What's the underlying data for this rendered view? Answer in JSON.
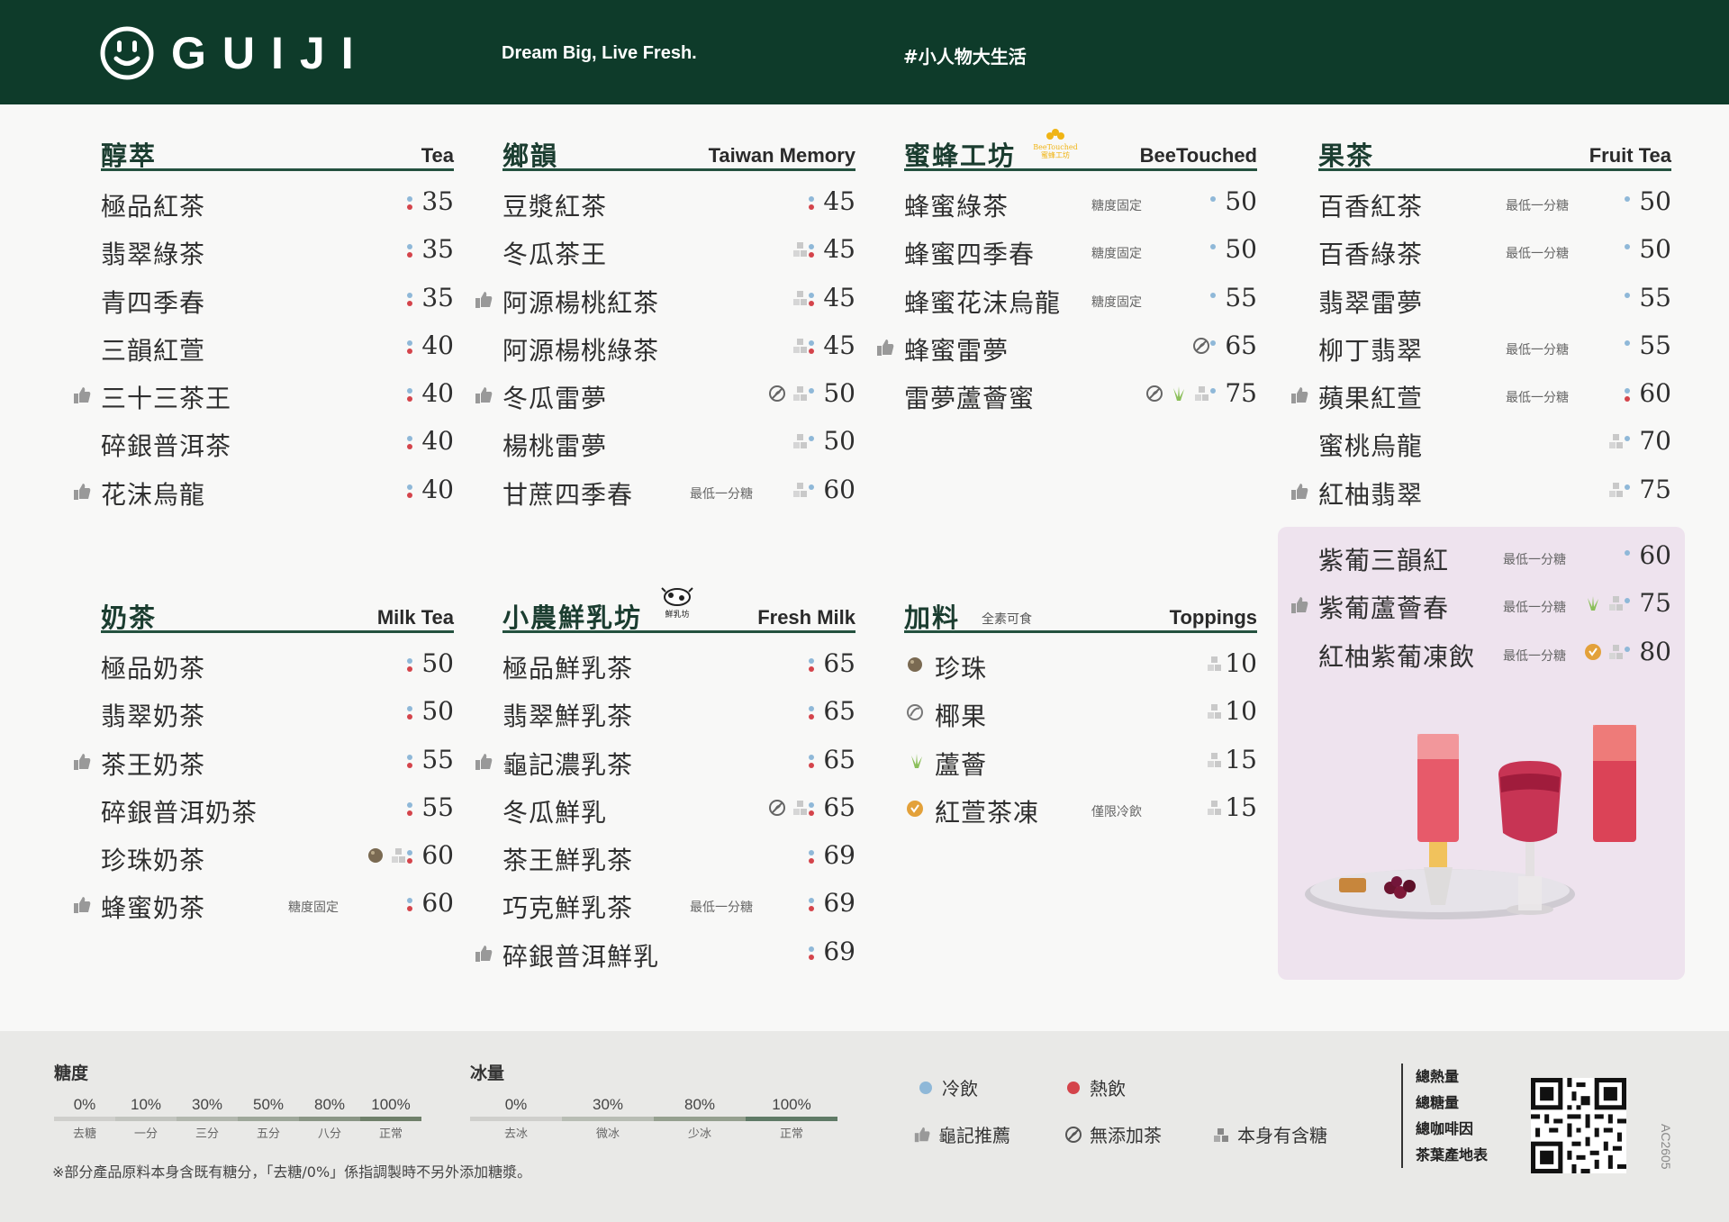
{
  "brand": {
    "name": "GUIJI",
    "tagline": "Dream Big, Live Fresh.",
    "hashtag": "#小人物大生活",
    "color": "#0e3b2a"
  },
  "sections": [
    {
      "id": "tea",
      "title_zh": "醇萃",
      "title_en": "Tea",
      "items": [
        {
          "name": "極品紅茶",
          "price": "35",
          "temp": "both"
        },
        {
          "name": "翡翠綠茶",
          "price": "35",
          "temp": "both"
        },
        {
          "name": "青四季春",
          "price": "35",
          "temp": "both"
        },
        {
          "name": "三韻紅萱",
          "price": "40",
          "temp": "both"
        },
        {
          "name": "三十三茶王",
          "price": "40",
          "temp": "both",
          "rec": true
        },
        {
          "name": "碎銀普洱茶",
          "price": "40",
          "temp": "both"
        },
        {
          "name": "花沫烏龍",
          "price": "40",
          "temp": "both",
          "rec": true
        }
      ]
    },
    {
      "id": "taiwan",
      "title_zh": "鄉韻",
      "title_en": "Taiwan Memory",
      "items": [
        {
          "name": "豆漿紅茶",
          "price": "45",
          "temp": "both"
        },
        {
          "name": "冬瓜茶王",
          "price": "45",
          "temp": "both",
          "icons": [
            "sugar"
          ]
        },
        {
          "name": "阿源楊桃紅茶",
          "price": "45",
          "temp": "both",
          "icons": [
            "sugar"
          ],
          "rec": true
        },
        {
          "name": "阿源楊桃綠茶",
          "price": "45",
          "temp": "both",
          "icons": [
            "sugar"
          ]
        },
        {
          "name": "冬瓜雷夢",
          "price": "50",
          "temp": "cold",
          "icons": [
            "notea",
            "sugar"
          ],
          "rec": true
        },
        {
          "name": "楊桃雷夢",
          "price": "50",
          "temp": "cold",
          "icons": [
            "sugar"
          ]
        },
        {
          "name": "甘蔗四季春",
          "price": "60",
          "temp": "cold",
          "icons": [
            "sugar"
          ],
          "note": "最低一分糖"
        }
      ]
    },
    {
      "id": "bee",
      "title_zh": "蜜蜂工坊",
      "title_en": "BeeTouched",
      "badge_en": "BeeTouched",
      "badge_zh": "蜜蜂工坊",
      "items": [
        {
          "name": "蜂蜜綠茶",
          "price": "50",
          "temp": "cold",
          "note": "糖度固定"
        },
        {
          "name": "蜂蜜四季春",
          "price": "50",
          "temp": "cold",
          "note": "糖度固定"
        },
        {
          "name": "蜂蜜花沫烏龍",
          "price": "55",
          "temp": "cold",
          "note": "糖度固定"
        },
        {
          "name": "蜂蜜雷夢",
          "price": "65",
          "temp": "cold",
          "icons": [
            "notea"
          ],
          "rec": true
        },
        {
          "name": "雷夢蘆薈蜜",
          "price": "75",
          "temp": "cold",
          "icons": [
            "notea",
            "aloe",
            "sugar"
          ]
        }
      ]
    },
    {
      "id": "fruit",
      "title_zh": "果茶",
      "title_en": "Fruit Tea",
      "items": [
        {
          "name": "百香紅茶",
          "price": "50",
          "temp": "cold",
          "note": "最低一分糖"
        },
        {
          "name": "百香綠茶",
          "price": "50",
          "temp": "cold",
          "note": "最低一分糖"
        },
        {
          "name": "翡翠雷夢",
          "price": "55",
          "temp": "cold"
        },
        {
          "name": "柳丁翡翠",
          "price": "55",
          "temp": "cold",
          "note": "最低一分糖"
        },
        {
          "name": "蘋果紅萱",
          "price": "60",
          "temp": "both",
          "note": "最低一分糖",
          "rec": true
        },
        {
          "name": "蜜桃烏龍",
          "price": "70",
          "temp": "cold",
          "icons": [
            "sugar"
          ]
        },
        {
          "name": "紅柚翡翠",
          "price": "75",
          "temp": "cold",
          "icons": [
            "sugar"
          ],
          "rec": true
        }
      ]
    },
    {
      "id": "grape",
      "title_zh": "",
      "title_en": "",
      "items": [
        {
          "name": "紫葡三韻紅",
          "price": "60",
          "temp": "cold",
          "note": "最低一分糖"
        },
        {
          "name": "紫葡蘆薈春",
          "price": "75",
          "temp": "cold",
          "note": "最低一分糖",
          "icons": [
            "aloe",
            "sugar"
          ],
          "rec": true
        },
        {
          "name": "紅柚紫葡凍飲",
          "price": "80",
          "temp": "cold",
          "note": "最低一分糖",
          "icons": [
            "jelly",
            "sugar"
          ]
        }
      ]
    },
    {
      "id": "milk",
      "title_zh": "奶茶",
      "title_en": "Milk Tea",
      "items": [
        {
          "name": "極品奶茶",
          "price": "50",
          "temp": "both"
        },
        {
          "name": "翡翠奶茶",
          "price": "50",
          "temp": "both"
        },
        {
          "name": "茶王奶茶",
          "price": "55",
          "temp": "both",
          "rec": true
        },
        {
          "name": "碎銀普洱奶茶",
          "price": "55",
          "temp": "both"
        },
        {
          "name": "珍珠奶茶",
          "price": "60",
          "temp": "both",
          "icons": [
            "pearl",
            "sugar"
          ]
        },
        {
          "name": "蜂蜜奶茶",
          "price": "60",
          "temp": "both",
          "note": "糖度固定",
          "rec": true
        }
      ]
    },
    {
      "id": "freshmilk",
      "title_zh": "小農鮮乳坊",
      "title_en": "Fresh Milk",
      "badge_zh": "鮮乳坊",
      "items": [
        {
          "name": "極品鮮乳茶",
          "price": "65",
          "temp": "both"
        },
        {
          "name": "翡翠鮮乳茶",
          "price": "65",
          "temp": "both"
        },
        {
          "name": "龜記濃乳茶",
          "price": "65",
          "temp": "both",
          "rec": true
        },
        {
          "name": "冬瓜鮮乳",
          "price": "65",
          "temp": "both",
          "icons": [
            "notea",
            "sugar"
          ]
        },
        {
          "name": "茶王鮮乳茶",
          "price": "69",
          "temp": "both"
        },
        {
          "name": "巧克鮮乳茶",
          "price": "69",
          "temp": "both",
          "note": "最低一分糖"
        },
        {
          "name": "碎銀普洱鮮乳",
          "price": "69",
          "temp": "both",
          "rec": true
        }
      ]
    },
    {
      "id": "toppings",
      "title_zh": "加料",
      "title_en": "Toppings",
      "note": "全素可食",
      "items": [
        {
          "name": "珍珠",
          "price": "10",
          "icon": "pearl",
          "icons": [
            "sugar"
          ]
        },
        {
          "name": "椰果",
          "price": "10",
          "icon": "coconut",
          "icons": [
            "sugar"
          ]
        },
        {
          "name": "蘆薈",
          "price": "15",
          "icon": "aloe",
          "icons": [
            "sugar"
          ]
        },
        {
          "name": "紅萱茶凍",
          "price": "15",
          "icon": "jelly",
          "icons": [
            "sugar"
          ],
          "note": "僅限冷飲"
        }
      ]
    }
  ],
  "legend": {
    "sugar_title": "糖度",
    "sugar_levels": [
      {
        "value": "0%",
        "label": "去糖"
      },
      {
        "value": "10%",
        "label": "一分"
      },
      {
        "value": "30%",
        "label": "三分"
      },
      {
        "value": "50%",
        "label": "五分"
      },
      {
        "value": "80%",
        "label": "八分"
      },
      {
        "value": "100%",
        "label": "正常"
      }
    ],
    "ice_title": "冰量",
    "ice_levels": [
      {
        "value": "0%",
        "label": "去冰"
      },
      {
        "value": "30%",
        "label": "微冰"
      },
      {
        "value": "80%",
        "label": "少冰"
      },
      {
        "value": "100%",
        "label": "正常"
      }
    ],
    "note": "※部分產品原料本身含既有糖分，「去糖/0%」係指調製時不另外添加糖漿。",
    "keys": {
      "cold": "冷飲",
      "hot": "熱飲",
      "recommend": "龜記推薦",
      "no_tea": "無添加茶",
      "has_sugar": "本身有含糖"
    },
    "info_links": [
      "總熱量",
      "總糖量",
      "總咖啡因",
      "茶葉產地表"
    ],
    "code": "AC2605"
  },
  "colors": {
    "accent": "#24513f",
    "cold": "#8fb8d8",
    "hot": "#d4444b",
    "feature_bg": "#eee3ee"
  }
}
